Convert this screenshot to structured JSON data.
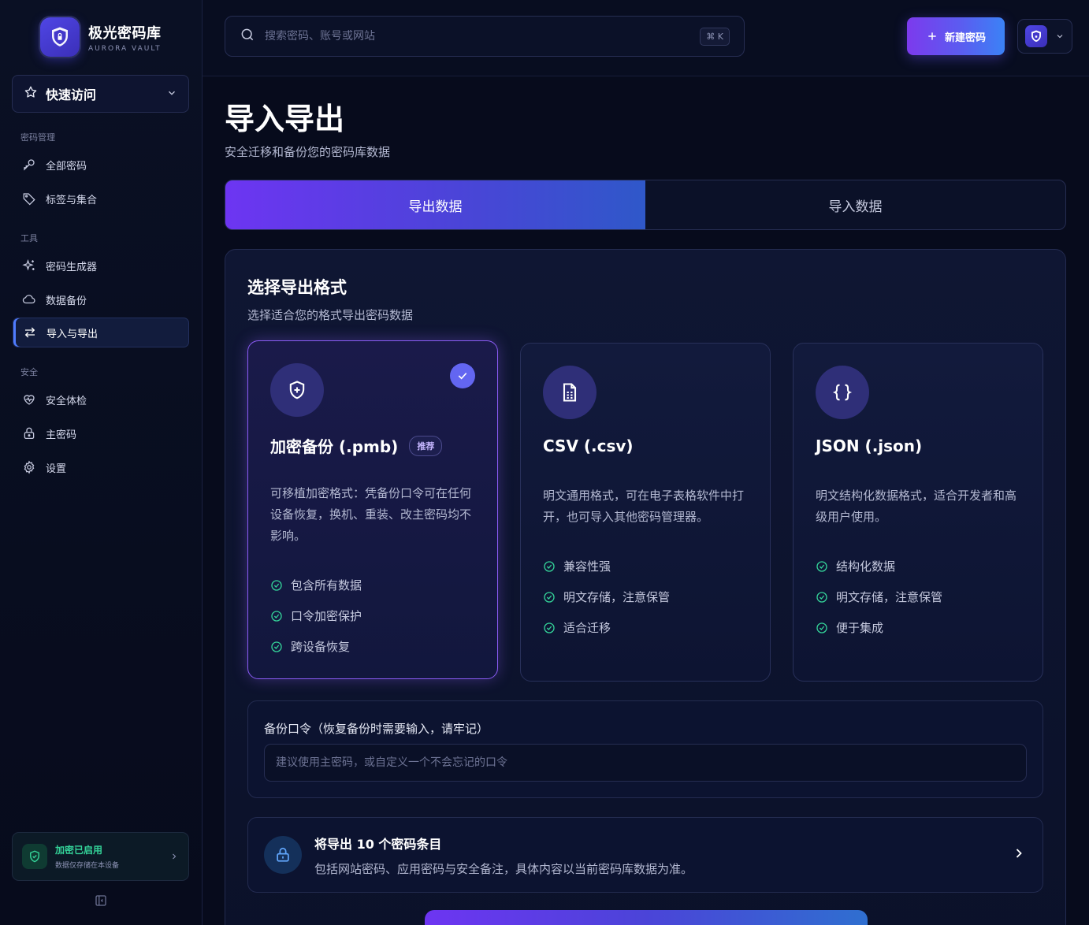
{
  "brand": {
    "name": "极光密码库",
    "subtitle": "AURORA VAULT"
  },
  "sidebar": {
    "quick_access": "快速访问",
    "sections": [
      {
        "title": "密码管理",
        "items": [
          {
            "label": "全部密码",
            "icon": "key-icon"
          },
          {
            "label": "标签与集合",
            "icon": "tag-icon"
          }
        ]
      },
      {
        "title": "工具",
        "items": [
          {
            "label": "密码生成器",
            "icon": "sparkles-icon"
          },
          {
            "label": "数据备份",
            "icon": "cloud-icon"
          },
          {
            "label": "导入与导出",
            "icon": "arrows-swap-icon",
            "active": true
          }
        ]
      },
      {
        "title": "安全",
        "items": [
          {
            "label": "安全体检",
            "icon": "heart-pulse-icon"
          },
          {
            "label": "主密码",
            "icon": "lock-icon"
          },
          {
            "label": "设置",
            "icon": "gear-icon"
          }
        ]
      }
    ],
    "status": {
      "title": "加密已启用",
      "subtitle": "数据仅存储在本设备"
    }
  },
  "header": {
    "search_placeholder": "搜索密码、账号或网站",
    "shortcut": "⌘ K",
    "new_button": "新建密码"
  },
  "page": {
    "title": "导入导出",
    "subtitle": "安全迁移和备份您的密码库数据",
    "tabs": [
      {
        "label": "导出数据",
        "active": true
      },
      {
        "label": "导入数据",
        "active": false
      }
    ]
  },
  "export": {
    "title": "选择导出格式",
    "subtitle": "选择适合您的格式导出密码数据",
    "formats": [
      {
        "title": "加密备份 (.pmb)",
        "badge": "推荐",
        "selected": true,
        "icon": "shield-plus-icon",
        "description": "可移植加密格式：凭备份口令可在任何设备恢复，换机、重装、改主密码均不影响。",
        "features": [
          "包含所有数据",
          "口令加密保护",
          "跨设备恢复"
        ]
      },
      {
        "title": "CSV (.csv)",
        "badge": "",
        "selected": false,
        "icon": "spreadsheet-file-icon",
        "description": "明文通用格式，可在电子表格软件中打开，也可导入其他密码管理器。",
        "features": [
          "兼容性强",
          "明文存储，注意保管",
          "适合迁移"
        ]
      },
      {
        "title": "JSON (.json)",
        "badge": "",
        "selected": false,
        "icon": "braces-icon",
        "description": "明文结构化数据格式，适合开发者和高级用户使用。",
        "features": [
          "结构化数据",
          "明文存储，注意保管",
          "便于集成"
        ]
      }
    ],
    "passphrase_label": "备份口令（恢复备份时需要输入，请牢记）",
    "passphrase_placeholder": "建议使用主密码，或自定义一个不会忘记的口令",
    "info_title": "将导出 10 个密码条目",
    "info_subtitle": "包括网站密码、应用密码与安全备注，具体内容以当前密码库数据为准。"
  },
  "colors": {
    "accent": "#6d35f2",
    "accent_blue": "#3b82f6",
    "success": "#34d399"
  }
}
